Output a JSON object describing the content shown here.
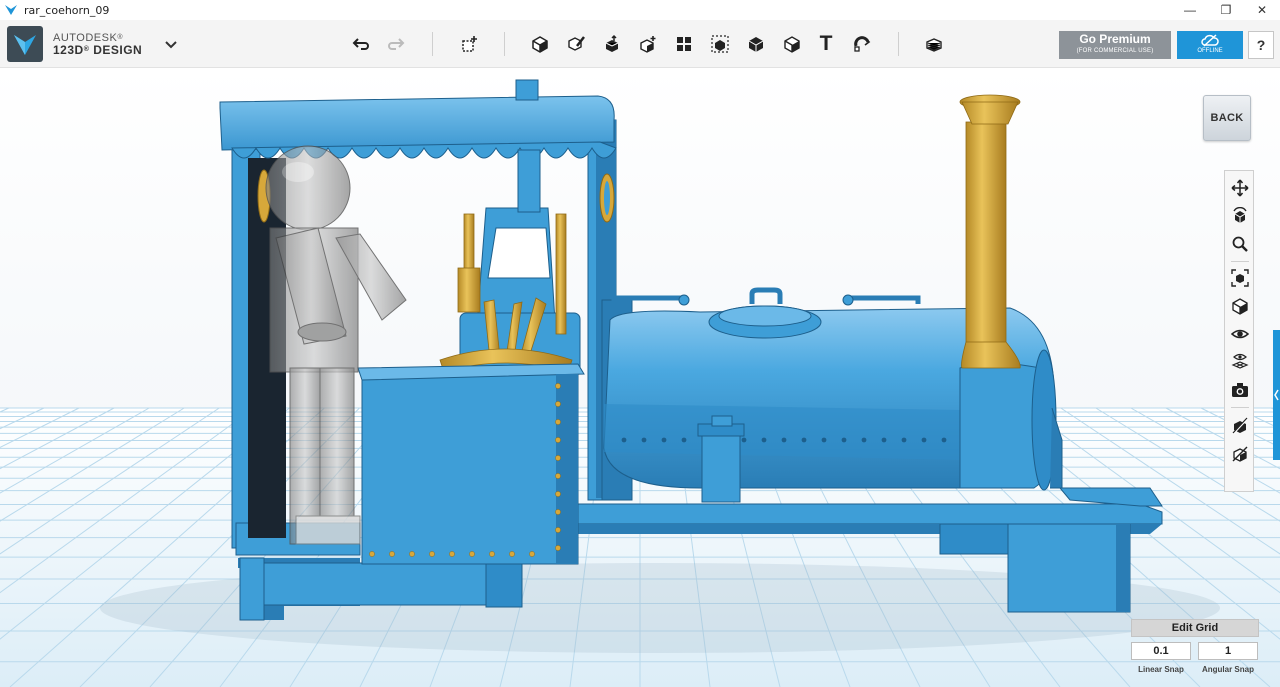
{
  "window": {
    "title": "rar_coehorn_09",
    "minimize_glyph": "—",
    "maximize_glyph": "❐",
    "close_glyph": "✕"
  },
  "app": {
    "brand_line1": "AUTODESK",
    "brand_line2": "123D",
    "brand_line3": "DESIGN",
    "registered_mark": "®"
  },
  "toolbar": {
    "tools": [
      {
        "name": "undo-icon"
      },
      {
        "name": "redo-icon"
      },
      {
        "name": "transform-icon"
      },
      {
        "name": "primitives-icon"
      },
      {
        "name": "sketch-icon"
      },
      {
        "name": "construct-icon"
      },
      {
        "name": "modify-icon"
      },
      {
        "name": "pattern-icon"
      },
      {
        "name": "grouping-icon"
      },
      {
        "name": "combine-icon"
      },
      {
        "name": "measure-icon"
      },
      {
        "name": "text-icon"
      },
      {
        "name": "snap-icon"
      },
      {
        "name": "material-icon"
      }
    ],
    "text_tool_glyph": "T",
    "premium_label": "Go Premium",
    "premium_sublabel": "(FOR COMMERCIAL USE)",
    "offline_label": "OFFLINE",
    "help_label": "?"
  },
  "viewport": {
    "back_label": "BACK",
    "nav_tools": [
      {
        "name": "pan-icon"
      },
      {
        "name": "orbit-icon"
      },
      {
        "name": "zoom-icon"
      },
      {
        "name": "fit-icon"
      },
      {
        "name": "view-icon"
      },
      {
        "name": "visibility-icon"
      },
      {
        "name": "grid-visibility-icon"
      },
      {
        "name": "snapshot-icon"
      },
      {
        "name": "material-toggle-icon"
      },
      {
        "name": "outline-toggle-icon"
      }
    ],
    "grid": {
      "edit_label": "Edit Grid",
      "linear_snap_value": "0.1",
      "angular_snap_value": "1",
      "linear_snap_label": "Linear Snap",
      "angular_snap_label": "Angular Snap"
    }
  },
  "colors": {
    "model_blue": "#3e9ed7",
    "model_blue_dark": "#2a7db5",
    "brass": "#d7a83a",
    "accent": "#1f95d8",
    "grid_line": "#b9d9ec"
  }
}
